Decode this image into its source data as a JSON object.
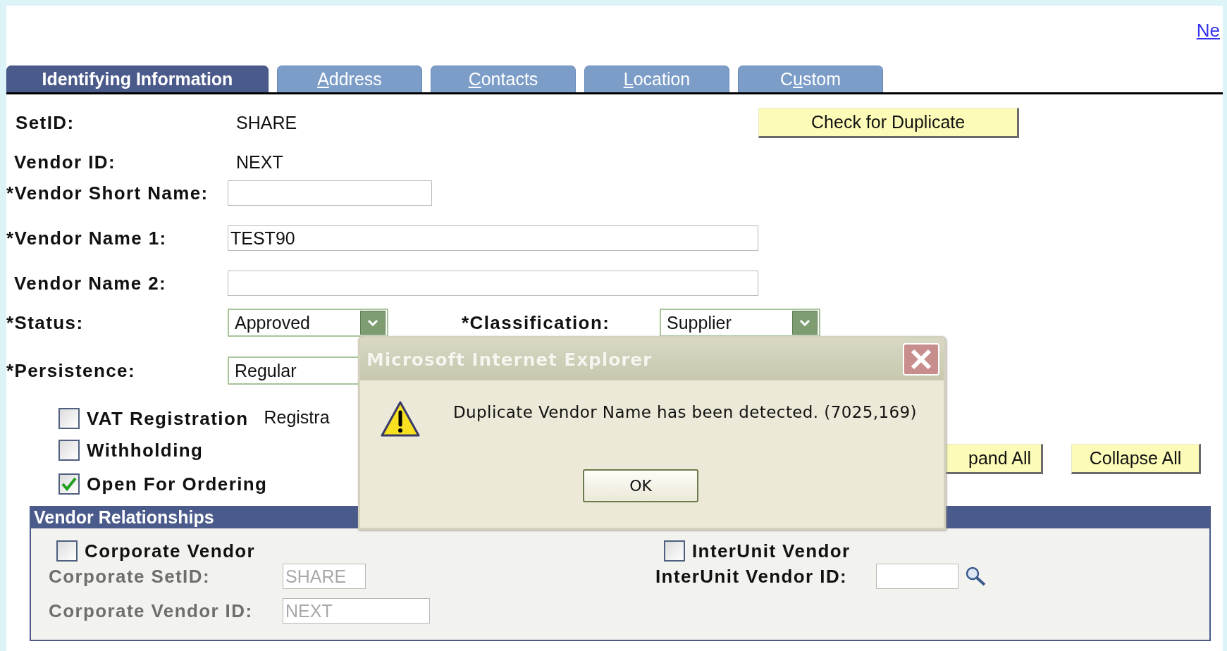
{
  "top_link": "Ne",
  "tabs": [
    {
      "before": "Identifying Information",
      "selected": true
    },
    {
      "key": "A",
      "after": "ddress",
      "selected": false
    },
    {
      "key": "C",
      "after": "ontacts",
      "selected": false
    },
    {
      "key": "L",
      "after": "ocation",
      "selected": false
    },
    {
      "before": "C",
      "key": "u",
      "after": "stom",
      "selected": false
    }
  ],
  "form": {
    "setid": {
      "label": "SetID:",
      "value": "SHARE"
    },
    "vendor_id": {
      "label": "Vendor ID:",
      "value": "NEXT"
    },
    "check_button": "Check for Duplicate",
    "short_name": {
      "label": "*Vendor Short Name:"
    },
    "name1": {
      "label": "*Vendor Name 1:",
      "value": "TEST90"
    },
    "name2": {
      "label": "Vendor Name 2:"
    },
    "status": {
      "label": "*Status:",
      "value": "Approved"
    },
    "classification": {
      "label": "*Classification:",
      "value": "Supplier"
    },
    "persistence": {
      "label": "*Persistence:",
      "value": "Regular"
    },
    "checkboxes": [
      {
        "label": "VAT Registration",
        "checked": false
      },
      {
        "label": "Withholding",
        "checked": false
      },
      {
        "label": "Open For Ordering",
        "checked": true
      }
    ],
    "registration_text": "Registra",
    "buttons": [
      "pand All",
      "Collapse All"
    ]
  },
  "vendor_relationships": {
    "title": "Vendor Relationships",
    "corporate_vendor": {
      "label": "Corporate Vendor",
      "checked": false
    },
    "corporate_setid": {
      "label": "Corporate SetID:",
      "value": "SHARE",
      "disabled": true
    },
    "corporate_vendor_id": {
      "label": "Corporate Vendor ID:",
      "value": "NEXT",
      "disabled": true
    },
    "interunit_vendor": {
      "label": "InterUnit Vendor",
      "checked": false
    },
    "interunit_vendor_id": {
      "label": "InterUnit Vendor ID:"
    }
  },
  "dialog": {
    "title": "Microsoft Internet Explorer",
    "message": "Duplicate Vendor Name has been detected. (7025,169)",
    "button": "OK"
  }
}
